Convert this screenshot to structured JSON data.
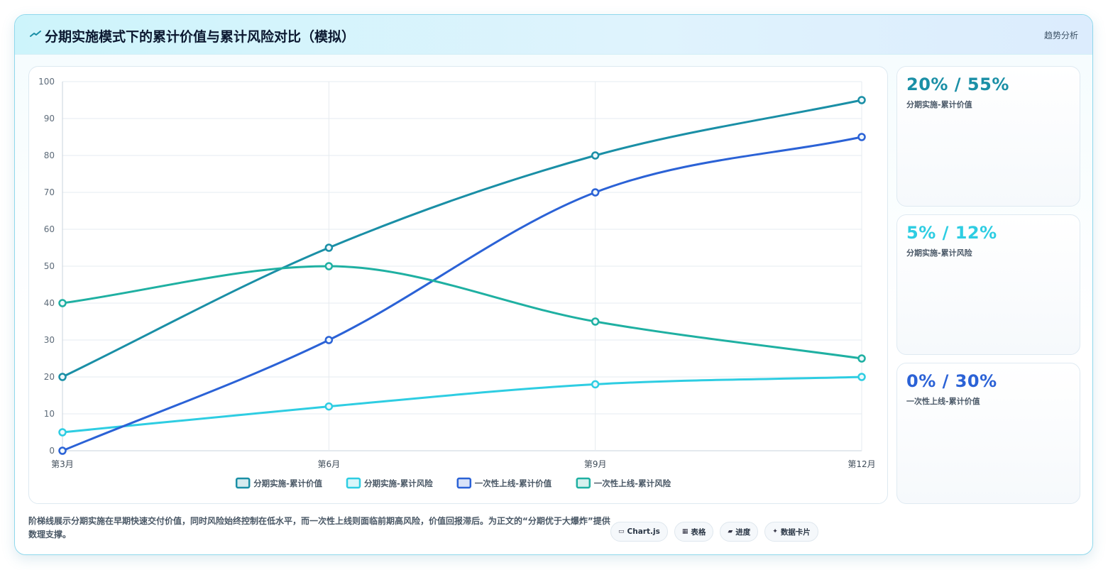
{
  "header": {
    "title": "分期实施模式下的累计价值与累计风险对比（模拟）",
    "tag": "趋势分析"
  },
  "colors": {
    "value_staged": "#1a8fa6",
    "risk_staged": "#2ecde2",
    "value_bigbang": "#2b62d6",
    "risk_bigbang": "#1fb0a2"
  },
  "chart_data": {
    "type": "line",
    "categories": [
      "第3月",
      "第6月",
      "第9月",
      "第12月"
    ],
    "ylim": [
      0,
      100
    ],
    "yticks": [
      0,
      10,
      20,
      30,
      40,
      50,
      60,
      70,
      80,
      90,
      100
    ],
    "grid": true,
    "legend_position": "bottom",
    "series": [
      {
        "name": "分期实施-累计价值",
        "color": "#1a8fa6",
        "values": [
          20,
          55,
          80,
          95
        ]
      },
      {
        "name": "分期实施-累计风险",
        "color": "#2ecde2",
        "values": [
          5,
          12,
          18,
          20
        ]
      },
      {
        "name": "一次性上线-累计价值",
        "color": "#2b62d6",
        "values": [
          0,
          30,
          70,
          85
        ]
      },
      {
        "name": "一次性上线-累计风险",
        "color": "#1fb0a2",
        "values": [
          40,
          50,
          35,
          25
        ]
      }
    ]
  },
  "stats": [
    {
      "value": "20% / 55%",
      "label": "分期实施-累计价值",
      "color": "#1a8fa6"
    },
    {
      "value": "5% / 12%",
      "label": "分期实施-累计风险",
      "color": "#2ecde2"
    },
    {
      "value": "0% / 30%",
      "label": "一次性上线-累计价值",
      "color": "#2b62d6"
    }
  ],
  "footnote": "阶梯线展示分期实施在早期快速交付价值，同时风险始终控制在低水平，而一次性上线则面临前期高风险，价值回报滞后。为正文的“分期优于大爆炸”提供数理支撑。",
  "chips": [
    {
      "icon": "▭",
      "label": "Chart.js"
    },
    {
      "icon": "▦",
      "label": "表格"
    },
    {
      "icon": "▰",
      "label": "进度"
    },
    {
      "icon": "✦",
      "label": "数据卡片"
    }
  ]
}
